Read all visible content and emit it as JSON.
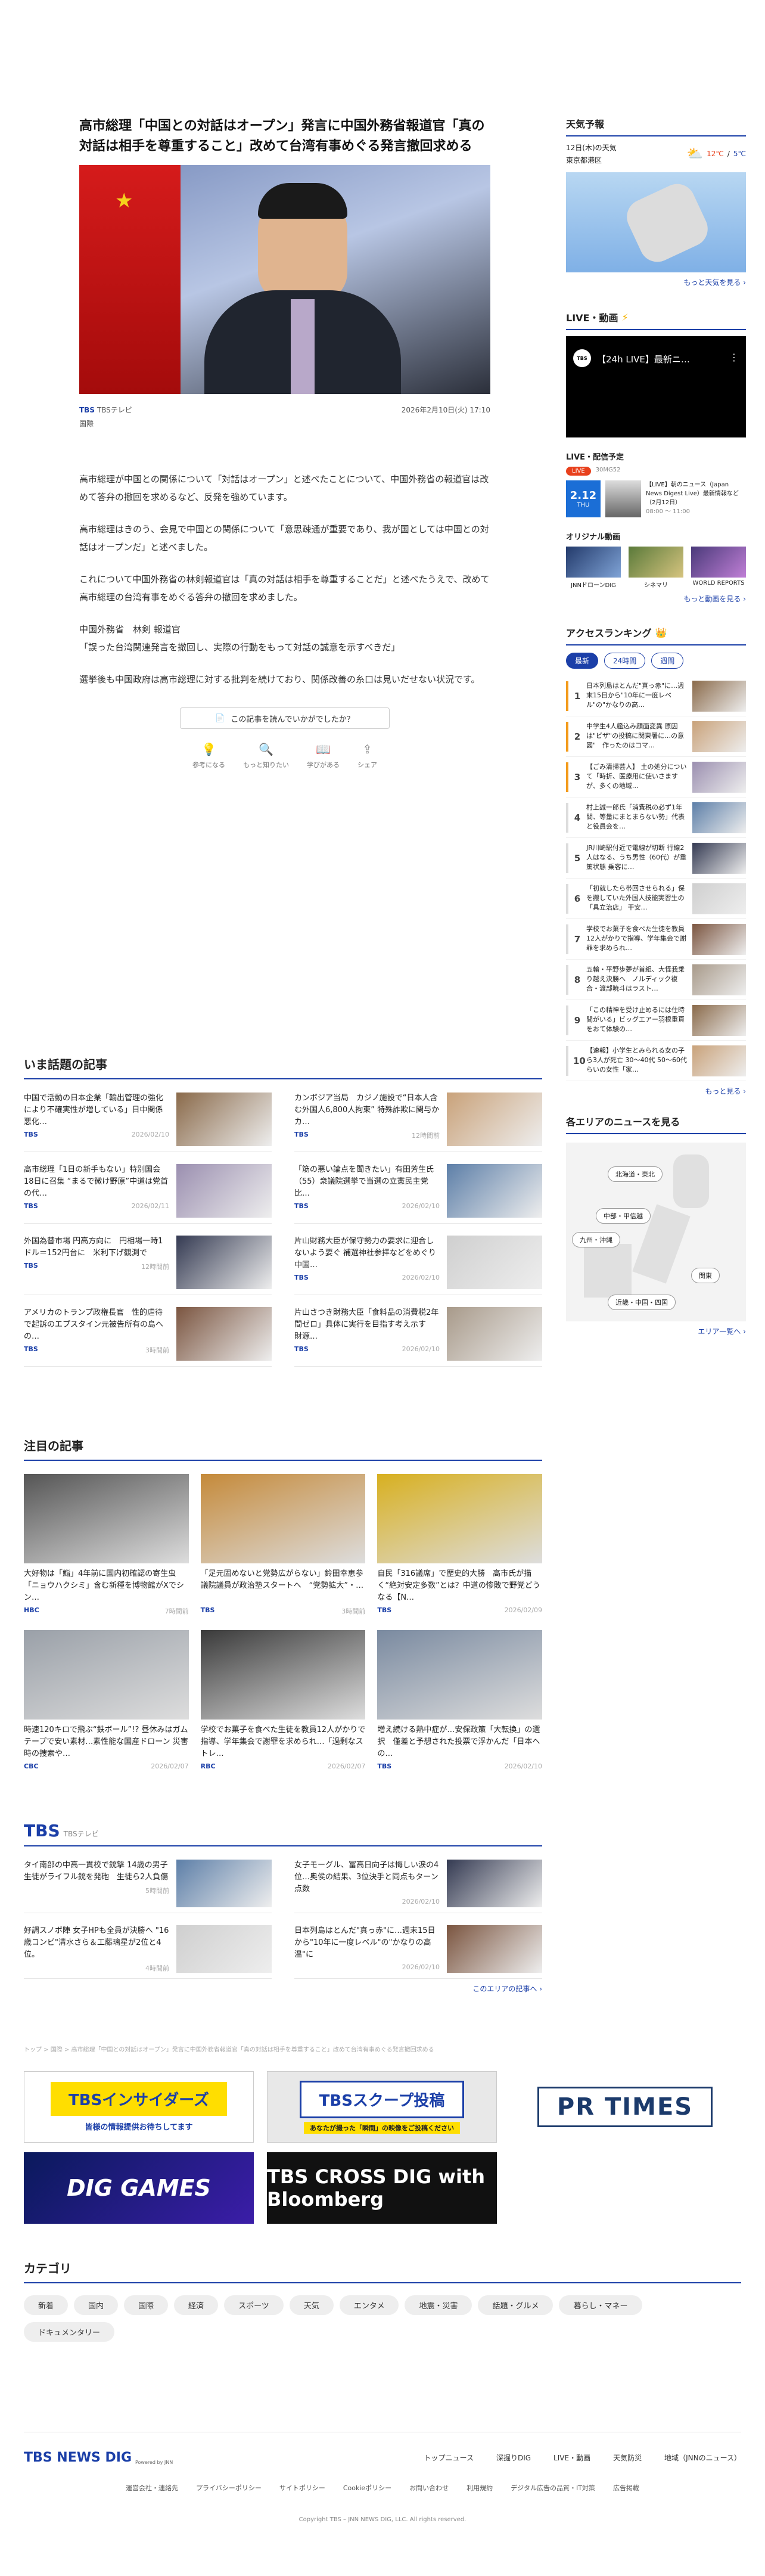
{
  "article": {
    "title": "高市総理「中国との対話はオープン」発言に中国外務省報道官「真の対話は相手を尊重すること」改めて台湾有事めぐる発言撤回求める",
    "source": "TBSテレビ",
    "date": "2026年2月10日(火) 17:10",
    "category": "国際",
    "paragraphs": [
      "高市総理が中国との関係について「対話はオープン」と述べたことについて、中国外務省の報道官は改めて答弁の撤回を求めるなど、反発を強めています。",
      "高市総理はきのう、会見で中国との関係について「意思疎通が重要であり、我が国としては中国との対話はオープンだ」と述べました。",
      "これについて中国外務省の林剣報道官は「真の対話は相手を尊重することだ」と述べたうえで、改めて高市総理の台湾有事をめぐる答弁の撤回を求めました。",
      "中国外務省　林剣 報道官\n「誤った台湾関連発言を撤回し、実際の行動をもって対話の誠意を示すべきだ」",
      "選挙後も中国政府は高市総理に対する批判を続けており、関係改善の糸口は見いだせない状況です。"
    ],
    "ask_label": "この記事を読んでいかがでしたか？",
    "reactions": [
      "参考になる",
      "もっと知りたい",
      "学びがある",
      "シェア"
    ]
  },
  "trending": {
    "title": "いま話題の記事",
    "items": [
      {
        "title": "中国で活動の日本企業「輸出管理の強化により不確実性が増している」日中関係悪化…",
        "src": "TBS",
        "date": "2026/02/10"
      },
      {
        "title": "カンボジア当局　カジノ施設で“日本人含む外国人6,800人拘束” 特殊詐欺に関与か カ…",
        "src": "TBS",
        "date": "12時間前"
      },
      {
        "title": "高市総理「1日の新手もない」特別国会18日に召集 “まるで微け野原”中道は党首の代…",
        "src": "TBS",
        "date": "2026/02/11"
      },
      {
        "title": "「筋の悪い論点を聞きたい」有田芳生氏（55）衆議院選挙で当選の立憲民主党比…",
        "src": "TBS",
        "date": "2026/02/10"
      },
      {
        "title": "外国為替市場 円高方向に　円相場一時1ドル＝152円台に　米利下げ観測で",
        "src": "TBS",
        "date": "12時間前"
      },
      {
        "title": "片山財務大臣が保守勢力の要求に迎合しないよう要ぐ 補選神社参拝などをめぐり中国…",
        "src": "TBS",
        "date": "2026/02/10"
      },
      {
        "title": "アメリカのトランプ政権長官　性的虐待で起訴のエプスタイン元被告所有の島への…",
        "src": "TBS",
        "date": "3時間前"
      },
      {
        "title": "片山さつき財務大臣「食料品の消費税2年間ゼロ」具体に実行を目指す考え示す　財源…",
        "src": "TBS",
        "date": "2026/02/10"
      }
    ]
  },
  "featured": {
    "title": "注目の記事",
    "items": [
      {
        "title": "大好物は「鮨」4年前に国内初確認の寄生虫「ニョウハクシミ」含む新種を博物館がXでシン…",
        "src": "HBC",
        "date": "7時間前"
      },
      {
        "title": "「足元固めないと党勢広がらない」鈴田幸恵参議院議員が政治塾スタートへ　“党勢拡大”・…",
        "src": "TBS",
        "date": "3時間前"
      },
      {
        "title": "自民「316議席」で歴史的大勝　高市氏が描く“絶対安定多数”とは？中道の惨敗で野党どうなる【N…",
        "src": "TBS",
        "date": "2026/02/09"
      },
      {
        "title": "時速120キロで飛ぶ“鉄ボール”!? 昼休みはガムテープで安い素材…素性能な国産ドローン 災害時の捜索や…",
        "src": "CBC",
        "date": "2026/02/07"
      },
      {
        "title": "学校でお菓子を食べた生徒を教員12人がかりで指導、学年集会で謝罪を求められ…「過剰なストレ…",
        "src": "RBC",
        "date": "2026/02/07"
      },
      {
        "title": "増え続ける熱中症が…安保政策「大転換」の選択　僅差と予想された投票で浮かんだ「日本への…",
        "src": "TBS",
        "date": "2026/02/10"
      }
    ]
  },
  "tbs": {
    "label": "TBS",
    "sub": "TBSテレビ",
    "items": [
      {
        "title": "タイ南部の中高一貫校で銃撃 14歳の男子生徒がライフル銃を発砲　生徒ら2人負傷",
        "date": "5時間前"
      },
      {
        "title": "女子モーグル、冨高日向子は悔しい涙の4位…奥侯の結果、3位決手と同点もターン点数",
        "date": "2026/02/10"
      },
      {
        "title": "好調スノボ陣 女子HPも全員が決勝へ \"16歳コンビ\"清水さら＆工藤璃星が2位と4位。",
        "date": "4時間前"
      },
      {
        "title": "日本列島はとんだ\"真っ赤\"に…週末15日から\"10年に一度レベル\"の\"かなりの高温\"に",
        "date": "2026/02/10"
      }
    ],
    "more": "このエリアの記事へ ›"
  },
  "breadcrumb": "トップ > 国際 > 高市総理「中国との対話はオープン」発言に中国外務省報道官「真の対話は相手を尊重すること」改めて台湾有事めぐる発言撤回求める",
  "banners": [
    "TBSインサイダーズ",
    "TBSスクープ投稿",
    "PR TIMES",
    "DIG GAMES",
    "TBS CROSS DIG with Bloomberg"
  ],
  "banner_sub": [
    "皆様の情報提供お待ちしてます",
    "あなたが撮った「瞬間」の映像をご投稿ください"
  ],
  "categories": {
    "title": "カテゴリ",
    "items": [
      "新着",
      "国内",
      "国際",
      "経済",
      "スポーツ",
      "天気",
      "エンタメ",
      "地震・災害",
      "話題・グルメ",
      "暮らし・マネー",
      "ドキュメンタリー"
    ]
  },
  "weather": {
    "title": "天気予報",
    "date": "12日(木)の天気",
    "city": "東京都港区",
    "hi": "12℃",
    "lo": "5℃",
    "more": "もっと天気を見る ›"
  },
  "live": {
    "title": "LIVE・動画",
    "video_title": "【24h LIVE】最新ニ…",
    "schedule_title": "LIVE・配信予定",
    "badge": "LIVE",
    "tag": "30MG52",
    "date": "2.12",
    "day": "THU",
    "prog": "【LIVE】朝のニュース（Japan News Digest Live）最新情報など（2月12日）",
    "time": "08:00 〜 11:00",
    "orig_title": "オリジナル動画",
    "origs": [
      "JNNドローンDIG",
      "シネマリ",
      "WORLD REPORTS"
    ],
    "more": "もっと動画を見る ›"
  },
  "ranking": {
    "title": "アクセスランキング",
    "tabs": [
      "最新",
      "24時間",
      "週間"
    ],
    "items": [
      "日本列島はとんだ\"真っ赤\"に…週末15日から\"10年に一度レベル\"の\"かなりの高…",
      "中学生4人艦込み顔面変異 原因は\"ビザ\"の投稿に関東署に…の意図\"　作ったのはコマ…",
      "【ごみ清掃芸人】 土の処分について「時折、医療用に使いさますが、多くの地域…",
      "村上誠一郎氏「消費税の必ず1年間、等量にまとまらない勢」代表と役員会を…",
      "JR川崎駅付近で電線が切断 行線2人はなる、うち男性（60代）が重篤状態 乗客に…",
      "「初就したら帯回させられる」保を搬していた外国人技能実習生の「具立治店」 干安…",
      "学校でお菓子を食べた生徒を教員12人がかりで指導、学年集会で謝罪を求められ…",
      "五輪・平野歩夢が首組、大怪我乗り越え決勝へ　ノルディック複合・渡部暁斗はラスト…",
      "「この精神を受け止めるには仕時間がいる」ビッグエアー羽根重頁をおて体験の…",
      "【速報】小学生とみられる女の子ら3人が死亡 30〜40代 50〜60代らいの女性「家…"
    ],
    "more": "もっと見る ›"
  },
  "area": {
    "title": "各エリアのニュースを見る",
    "regions": [
      "北海道・東北",
      "中部・甲信越",
      "九州・沖縄",
      "関東",
      "近畿・中国・四国"
    ],
    "more": "エリア一覧へ ›"
  },
  "footer": {
    "logo": "TBS NEWS DIG",
    "logo_sub": "Powered by JNN",
    "nav": [
      "トップニュース",
      "深掘りDIG",
      "LIVE・動画",
      "天気防災",
      "地域（JNNのニュース）"
    ],
    "links": [
      "運営会社・連絡先",
      "プライバシーポリシー",
      "サイトポリシー",
      "Cookieポリシー",
      "お問い合わせ",
      "利用規約",
      "デジタル広告の品質・IT対策",
      "広告掲載"
    ],
    "copyright": "Copyright TBS – JNN NEWS DIG, LLC. All rights reserved."
  },
  "colors": {
    "accent": "#1b3fa8",
    "tbs_blue": "#1b3fa8",
    "live_red": "#e8401c"
  }
}
